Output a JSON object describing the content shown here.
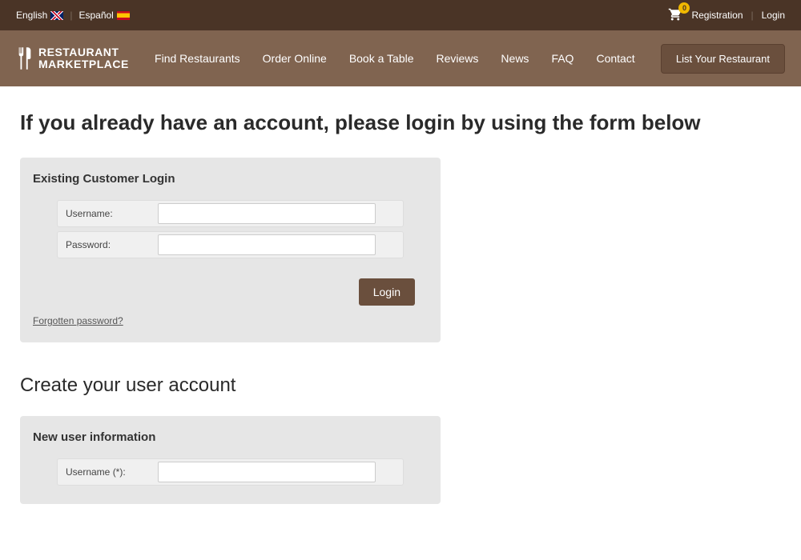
{
  "topbar": {
    "langs": [
      {
        "label": "English",
        "flag": "uk"
      },
      {
        "label": "Español",
        "flag": "es"
      }
    ],
    "cart_count": "0",
    "links": {
      "registration": "Registration",
      "login": "Login"
    }
  },
  "logo": {
    "line1": "RESTAURANT",
    "line2": "MARKETPLACE"
  },
  "nav": {
    "items": [
      "Find Restaurants",
      "Order Online",
      "Book a Table",
      "Reviews",
      "News",
      "FAQ",
      "Contact"
    ],
    "cta": "List Your Restaurant"
  },
  "login_section": {
    "heading": "If you already have an account, please login by using the form below",
    "panel_title": "Existing Customer Login",
    "username_label": "Username:",
    "password_label": "Password:",
    "button": "Login",
    "forgot": "Forgotten password?"
  },
  "create_section": {
    "heading": "Create your user account",
    "panel_title": "New user information",
    "username_label": "Username (*):"
  }
}
